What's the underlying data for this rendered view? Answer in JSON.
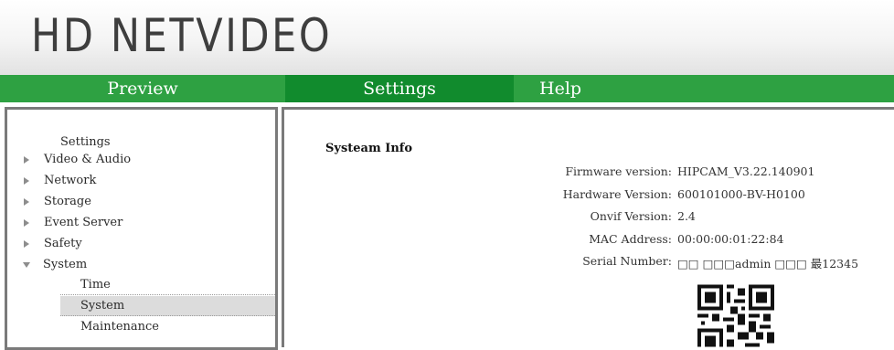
{
  "header": {
    "logo_text": "HD NETVIDEO"
  },
  "nav": {
    "tabs": [
      {
        "label": "Preview"
      },
      {
        "label": "Settings"
      },
      {
        "label": "Help"
      }
    ]
  },
  "sidebar": {
    "title": "Settings",
    "items": [
      {
        "label": "Video & Audio"
      },
      {
        "label": "Network"
      },
      {
        "label": "Storage"
      },
      {
        "label": "Event Server"
      },
      {
        "label": "Safety"
      },
      {
        "label": "System"
      }
    ],
    "sub_items": [
      {
        "label": "Time"
      },
      {
        "label": "System"
      },
      {
        "label": "Maintenance"
      }
    ]
  },
  "content": {
    "title": "Systeam Info",
    "rows": [
      {
        "label": "Firmware version:",
        "value": "HIPCAM_V3.22.140901"
      },
      {
        "label": "Hardware Version:",
        "value": "600101000-BV-H0100"
      },
      {
        "label": "Onvif Version:",
        "value": "2.4"
      },
      {
        "label": "MAC Address:",
        "value": "00:00:00:01:22:84"
      },
      {
        "label": "Serial Number:",
        "value": "□□ □□□admin □□□ 最12345"
      }
    ],
    "qr_icon": "qr-code-icon"
  },
  "colors": {
    "nav_green": "#2ea142",
    "nav_active": "#118b2d",
    "border_gray": "#7a7a7a"
  }
}
